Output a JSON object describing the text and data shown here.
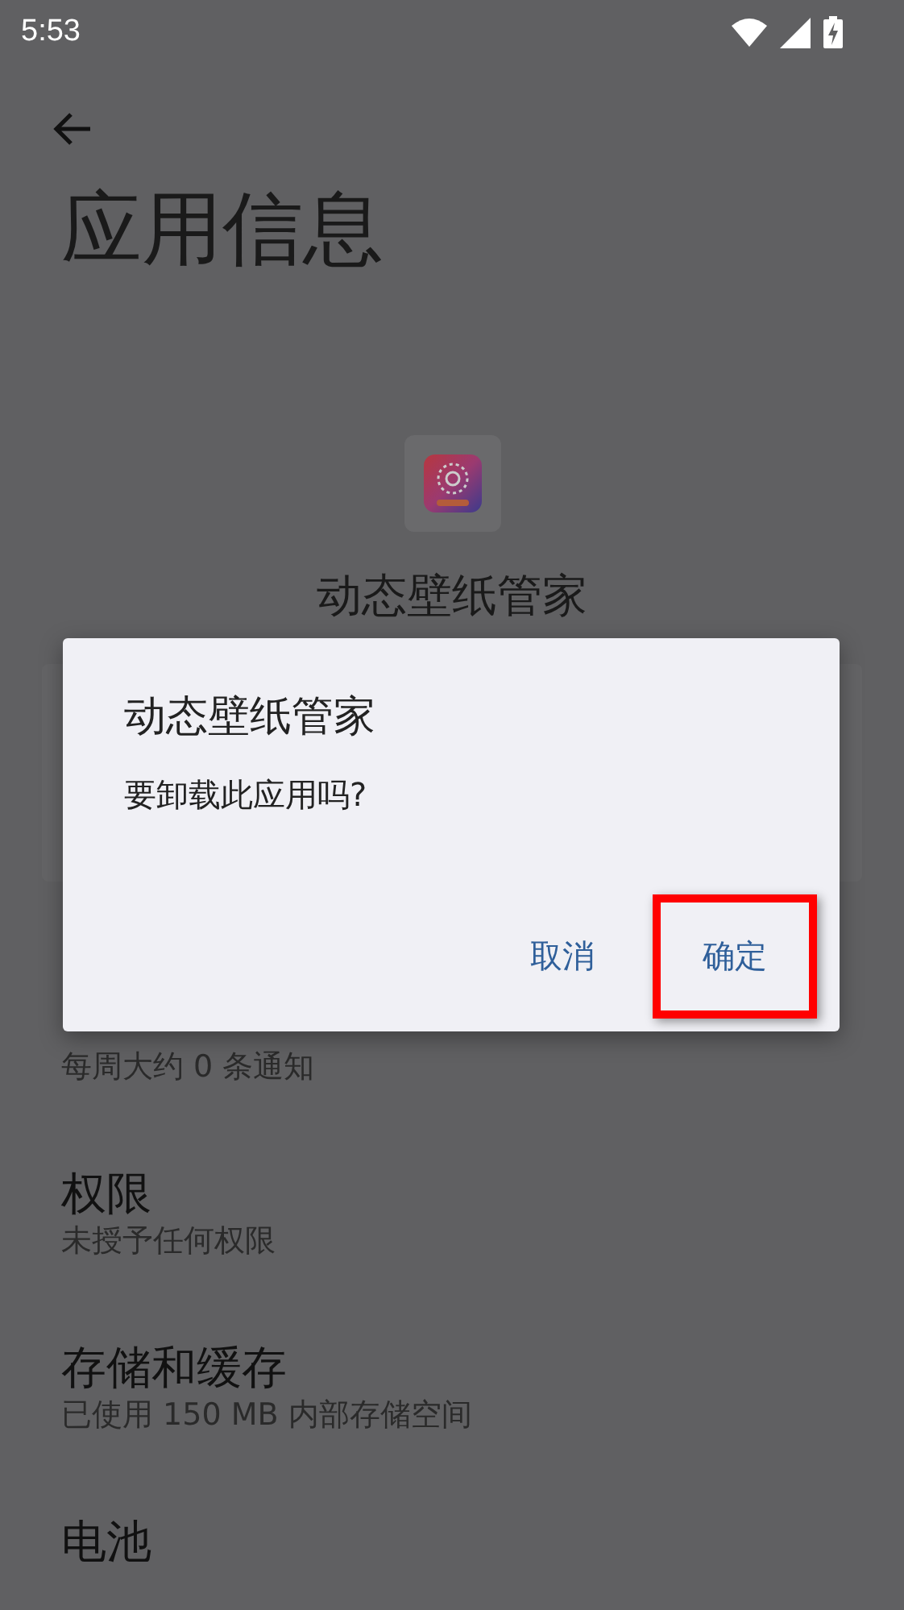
{
  "status_bar": {
    "time": "5:53"
  },
  "page": {
    "title": "应用信息",
    "app_name": "动态壁纸管家"
  },
  "settings": [
    {
      "summary": "每周大约 0 条通知"
    },
    {
      "title": "权限",
      "summary": "未授予任何权限"
    },
    {
      "title": "存储和缓存",
      "summary": "已使用 150 MB 内部存储空间"
    },
    {
      "title": "电池"
    }
  ],
  "dialog": {
    "title": "动态壁纸管家",
    "message": "要卸载此应用吗?",
    "buttons": [
      {
        "label": "取消",
        "highlighted": false
      },
      {
        "label": "确定",
        "highlighted": true
      }
    ]
  }
}
